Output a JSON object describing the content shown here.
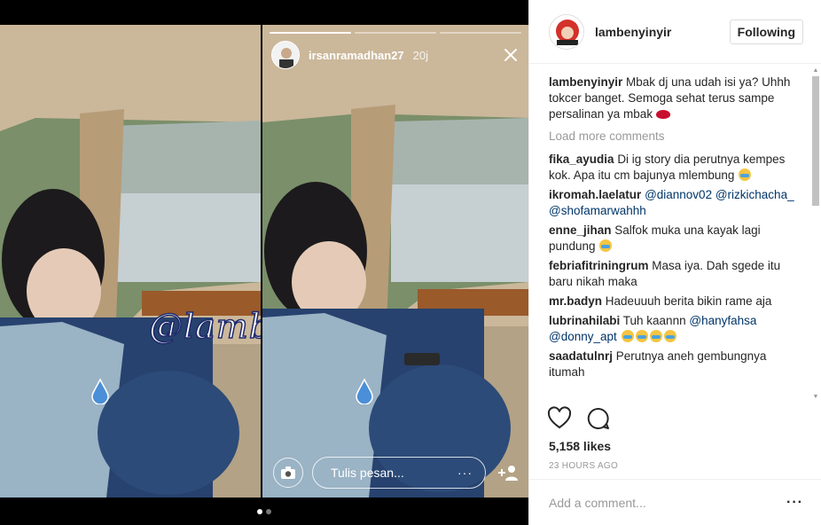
{
  "colors": {
    "accent": "#003569",
    "muted": "#999999",
    "watermark_outline": "#1f2a6b",
    "drop": "#4a8fd8"
  },
  "story": {
    "username": "irsanramadhan27",
    "time": "20j",
    "reply_placeholder": "Tulis pesan...",
    "reply_more": "···",
    "watermark": "@lambenyinyir",
    "close_icon": "close-icon",
    "camera_icon": "camera-icon",
    "add_friend_icon": "add-friend-icon"
  },
  "carousel": {
    "count": 2,
    "active": 1
  },
  "post": {
    "username": "lambenyinyir",
    "follow_label": "Following",
    "caption_user": "lambenyinyir",
    "caption_text": "Mbak dj una udah isi ya? Uhhh tokcer banget. Semoga sehat terus sampe persalinan ya mbak",
    "load_more": "Load more comments",
    "comments": [
      {
        "user": "fika_ayudia",
        "text": "Di ig story dia perutnya kempes kok. Apa itu cm bajunya mlembung"
      },
      {
        "user": "ikromah.laelatur",
        "mentions": [
          "@diannov02",
          "@rizkichacha_",
          "@shofamarwahhh"
        ]
      },
      {
        "user": "enne_jihan",
        "text": "Salfok muka una kayak lagi pundung"
      },
      {
        "user": "febriafitriningrum",
        "text": "Masa iya. Dah sgede itu baru nikah maka"
      },
      {
        "user": "mr.badyn",
        "text": "Hadeuuuh berita bikin rame aja"
      },
      {
        "user": "lubrinahilabi",
        "text": "Tuh kaannn",
        "mentions": [
          "@hanyfahsa",
          "@donny_apt"
        ]
      },
      {
        "user": "saadatulnrj",
        "text": "Perutnya aneh gembungnya itumah"
      }
    ],
    "likes": "5,158 likes",
    "time": "23 HOURS AGO",
    "add_comment_placeholder": "Add a comment...",
    "more_label": "···",
    "like_icon": "heart-icon",
    "comment_icon": "comment-icon"
  }
}
